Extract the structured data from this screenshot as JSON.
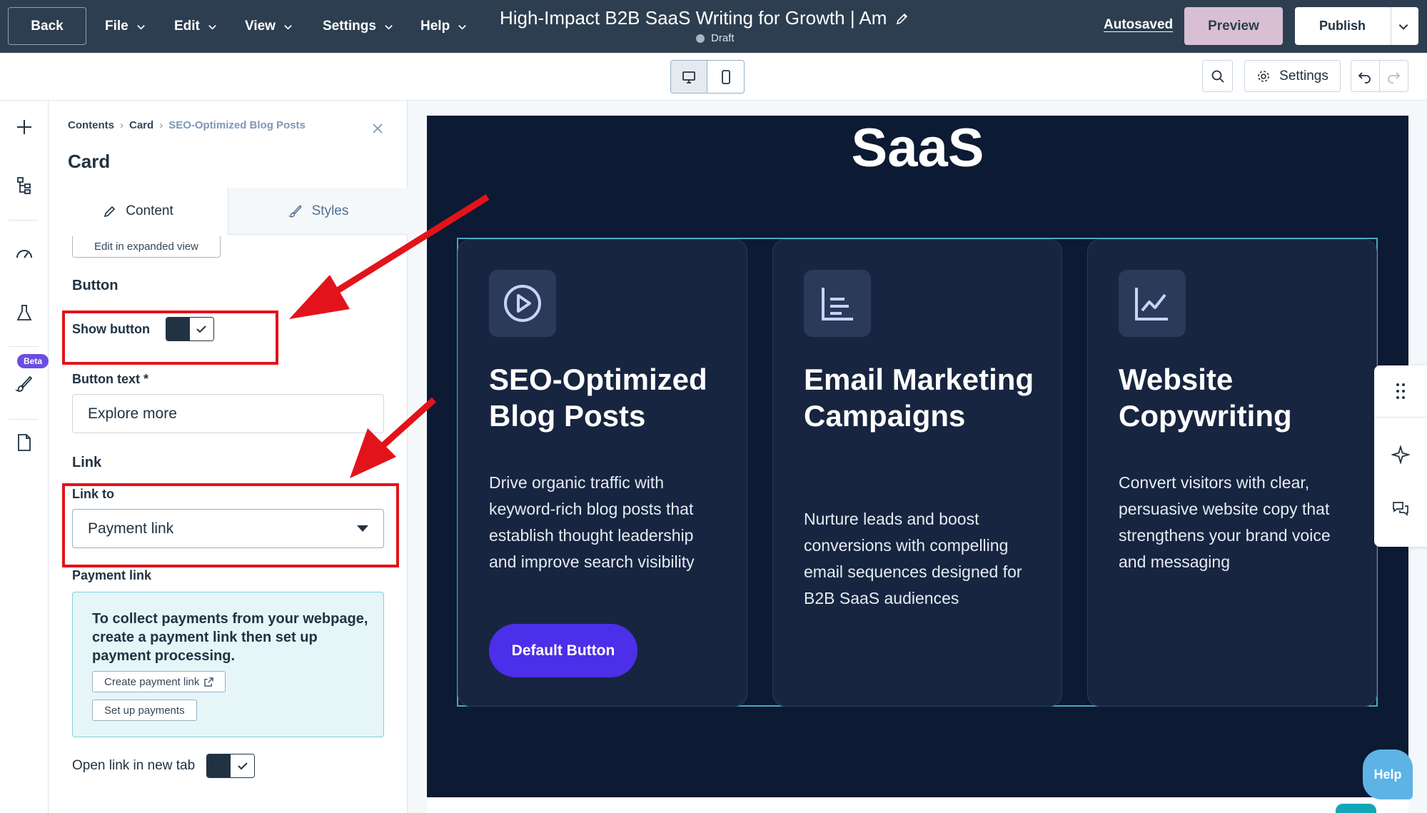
{
  "topbar": {
    "back_label": "Back",
    "menus": [
      {
        "label": "File"
      },
      {
        "label": "Edit"
      },
      {
        "label": "View"
      },
      {
        "label": "Settings"
      },
      {
        "label": "Help"
      }
    ],
    "document_title": "High-Impact B2B SaaS Writing for Growth | Am",
    "status": "Draft",
    "autosaved_label": "Autosaved",
    "preview_label": "Preview",
    "publish_label": "Publish"
  },
  "toolbar": {
    "settings_label": "Settings",
    "active_device": "desktop"
  },
  "rail": {
    "beta_label": "Beta",
    "icons": [
      "plus-icon",
      "tree-icon",
      "gauge-icon",
      "flask-icon",
      "brush-icon",
      "page-icon"
    ]
  },
  "panel": {
    "breadcrumbs": [
      "Contents",
      "Card",
      "SEO-Optimized Blog Posts"
    ],
    "title": "Card",
    "tabs": [
      {
        "label": "Content",
        "active": true
      },
      {
        "label": "Styles",
        "active": false
      }
    ],
    "expanded_view_label": "Edit in expanded view",
    "button_section": "Button",
    "show_button_label": "Show button",
    "show_button_on": true,
    "button_text_label": "Button text *",
    "button_text_value": "Explore more",
    "link_section": "Link",
    "link_to_label": "Link to",
    "link_to_value": "Payment link",
    "payment_link_label": "Payment link",
    "payment_info": "To collect payments from your webpage, create a payment link then set up payment processing.",
    "create_payment_link_label": "Create payment link",
    "setup_payments_label": "Set up payments",
    "open_new_tab_label": "Open link in new tab",
    "open_new_tab_on": true
  },
  "canvas": {
    "hero_title": "SaaS",
    "cards": [
      {
        "icon": "play-circle-icon",
        "title": "SEO-Optimized Blog Posts",
        "description": "Drive organic traffic with keyword-rich blog posts that establish thought leadership and improve search visibility",
        "button_label": "Default Button"
      },
      {
        "icon": "list-lines-icon",
        "title": "Email Marketing Campaigns",
        "description": "Nurture leads and boost conversions with compelling email sequences designed for B2B SaaS audiences"
      },
      {
        "icon": "line-chart-icon",
        "title": "Website Copywriting",
        "description": "Convert visitors with clear, persuasive website copy that strengthens your brand voice and messaging"
      }
    ],
    "help_label": "Help"
  },
  "colors": {
    "topbar": "#2d3e50",
    "page_bg": "#0c1a33",
    "card_bg": "#172540",
    "button": "#4c2fe8",
    "annotation": "#e3131b",
    "preview": "#d8bfd4"
  }
}
